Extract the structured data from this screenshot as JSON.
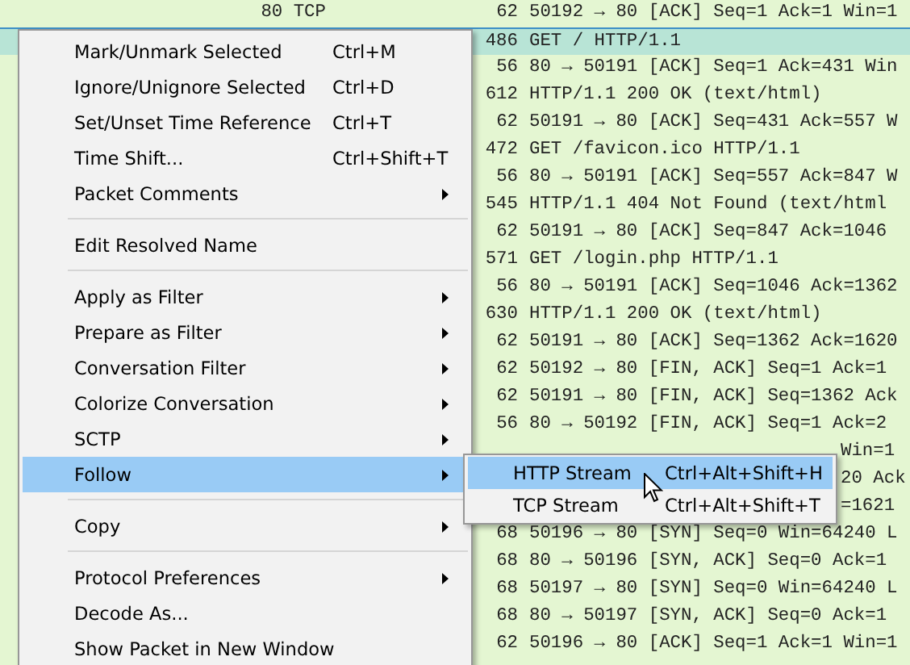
{
  "packets": [
    {
      "kind": "full",
      "column_1": "80 TCP",
      "length": "62",
      "info": "50192 → 80 [ACK] Seq=1 Ack=1 Win=1",
      "selected": false
    },
    {
      "kind": "full",
      "length": "486",
      "info": "GET / HTTP/1.1",
      "selected": true
    },
    {
      "kind": "full",
      "length": "56",
      "info": "80 → 50191 [ACK] Seq=1 Ack=431 Win",
      "selected": false
    },
    {
      "kind": "full",
      "length": "612",
      "info": "HTTP/1.1 200 OK  (text/html)",
      "selected": false
    },
    {
      "kind": "full",
      "length": "62",
      "info": "50191 → 80 [ACK] Seq=431 Ack=557 W",
      "selected": false
    },
    {
      "kind": "full",
      "length": "472",
      "info": "GET /favicon.ico HTTP/1.1",
      "selected": false
    },
    {
      "kind": "full",
      "length": "56",
      "info": "80 → 50191 [ACK] Seq=557 Ack=847 W",
      "selected": false
    },
    {
      "kind": "full",
      "length": "545",
      "info": "HTTP/1.1 404 Not Found  (text/html",
      "selected": false
    },
    {
      "kind": "full",
      "length": "62",
      "info": "50191 → 80 [ACK] Seq=847 Ack=1046",
      "selected": false
    },
    {
      "kind": "full",
      "length": "571",
      "info": "GET /login.php HTTP/1.1",
      "selected": false
    },
    {
      "kind": "full",
      "length": "56",
      "info": "80 → 50191 [ACK] Seq=1046 Ack=1362",
      "selected": false
    },
    {
      "kind": "full",
      "length": "630",
      "info": "HTTP/1.1 200 OK  (text/html)",
      "selected": false
    },
    {
      "kind": "full",
      "length": "62",
      "info": "50191 → 80 [ACK] Seq=1362 Ack=1620",
      "selected": false
    },
    {
      "kind": "full",
      "length": "62",
      "info": "50192 → 80 [FIN, ACK] Seq=1 Ack=1",
      "selected": false
    },
    {
      "kind": "full",
      "length": "62",
      "info": "50191 → 80 [FIN, ACK] Seq=1362 Ack",
      "selected": false
    },
    {
      "kind": "full",
      "length": "56",
      "info": "80 → 50192 [FIN, ACK] Seq=1 Ack=2",
      "selected": false
    },
    {
      "kind": "partial",
      "info": "Win=1",
      "selected": false
    },
    {
      "kind": "partial",
      "info": "20 Ack",
      "selected": false
    },
    {
      "kind": "partial",
      "info": "=1621",
      "selected": false
    },
    {
      "kind": "full",
      "length": "68",
      "info": "50196 → 80 [SYN] Seq=0 Win=64240 L",
      "selected": false
    },
    {
      "kind": "full",
      "length": "68",
      "info": "80 → 50196 [SYN, ACK] Seq=0 Ack=1",
      "selected": false
    },
    {
      "kind": "full",
      "length": "68",
      "info": "50197 → 80 [SYN] Seq=0 Win=64240 L",
      "selected": false
    },
    {
      "kind": "full",
      "length": "68",
      "info": "80 → 50197 [SYN, ACK] Seq=0 Ack=1",
      "selected": false
    },
    {
      "kind": "full",
      "length": "62",
      "info": "50196 → 80 [ACK] Seq=1 Ack=1 Win=1",
      "selected": false
    }
  ],
  "context_menu": {
    "items": [
      {
        "kind": "item",
        "label": "Mark/Unmark Selected",
        "shortcut": "Ctrl+M",
        "has_submenu": false,
        "selected": false
      },
      {
        "kind": "item",
        "label": "Ignore/Unignore Selected",
        "shortcut": "Ctrl+D",
        "has_submenu": false,
        "selected": false
      },
      {
        "kind": "item",
        "label": "Set/Unset Time Reference",
        "shortcut": "Ctrl+T",
        "has_submenu": false,
        "selected": false
      },
      {
        "kind": "item",
        "label": "Time Shift...",
        "shortcut": "Ctrl+Shift+T",
        "has_submenu": false,
        "selected": false
      },
      {
        "kind": "item",
        "label": "Packet Comments",
        "has_submenu": true,
        "selected": false
      },
      {
        "kind": "separator"
      },
      {
        "kind": "item",
        "label": "Edit Resolved Name",
        "has_submenu": false,
        "selected": false
      },
      {
        "kind": "separator"
      },
      {
        "kind": "item",
        "label": "Apply as Filter",
        "has_submenu": true,
        "selected": false
      },
      {
        "kind": "item",
        "label": "Prepare as Filter",
        "has_submenu": true,
        "selected": false
      },
      {
        "kind": "item",
        "label": "Conversation Filter",
        "has_submenu": true,
        "selected": false
      },
      {
        "kind": "item",
        "label": "Colorize Conversation",
        "has_submenu": true,
        "selected": false
      },
      {
        "kind": "item",
        "label": "SCTP",
        "has_submenu": true,
        "selected": false
      },
      {
        "kind": "item",
        "label": "Follow",
        "has_submenu": true,
        "selected": true
      },
      {
        "kind": "separator"
      },
      {
        "kind": "item",
        "label": "Copy",
        "has_submenu": true,
        "selected": false
      },
      {
        "kind": "separator"
      },
      {
        "kind": "item",
        "label": "Protocol Preferences",
        "has_submenu": true,
        "selected": false
      },
      {
        "kind": "item",
        "label": "Decode As...",
        "has_submenu": false,
        "selected": false
      },
      {
        "kind": "item",
        "label": "Show Packet in New Window",
        "has_submenu": false,
        "selected": false
      }
    ]
  },
  "submenu": {
    "items": [
      {
        "label": "HTTP Stream",
        "shortcut": "Ctrl+Alt+Shift+H",
        "selected": true
      },
      {
        "label": "TCP Stream",
        "shortcut": "Ctrl+Alt+Shift+T",
        "selected": false
      }
    ]
  }
}
